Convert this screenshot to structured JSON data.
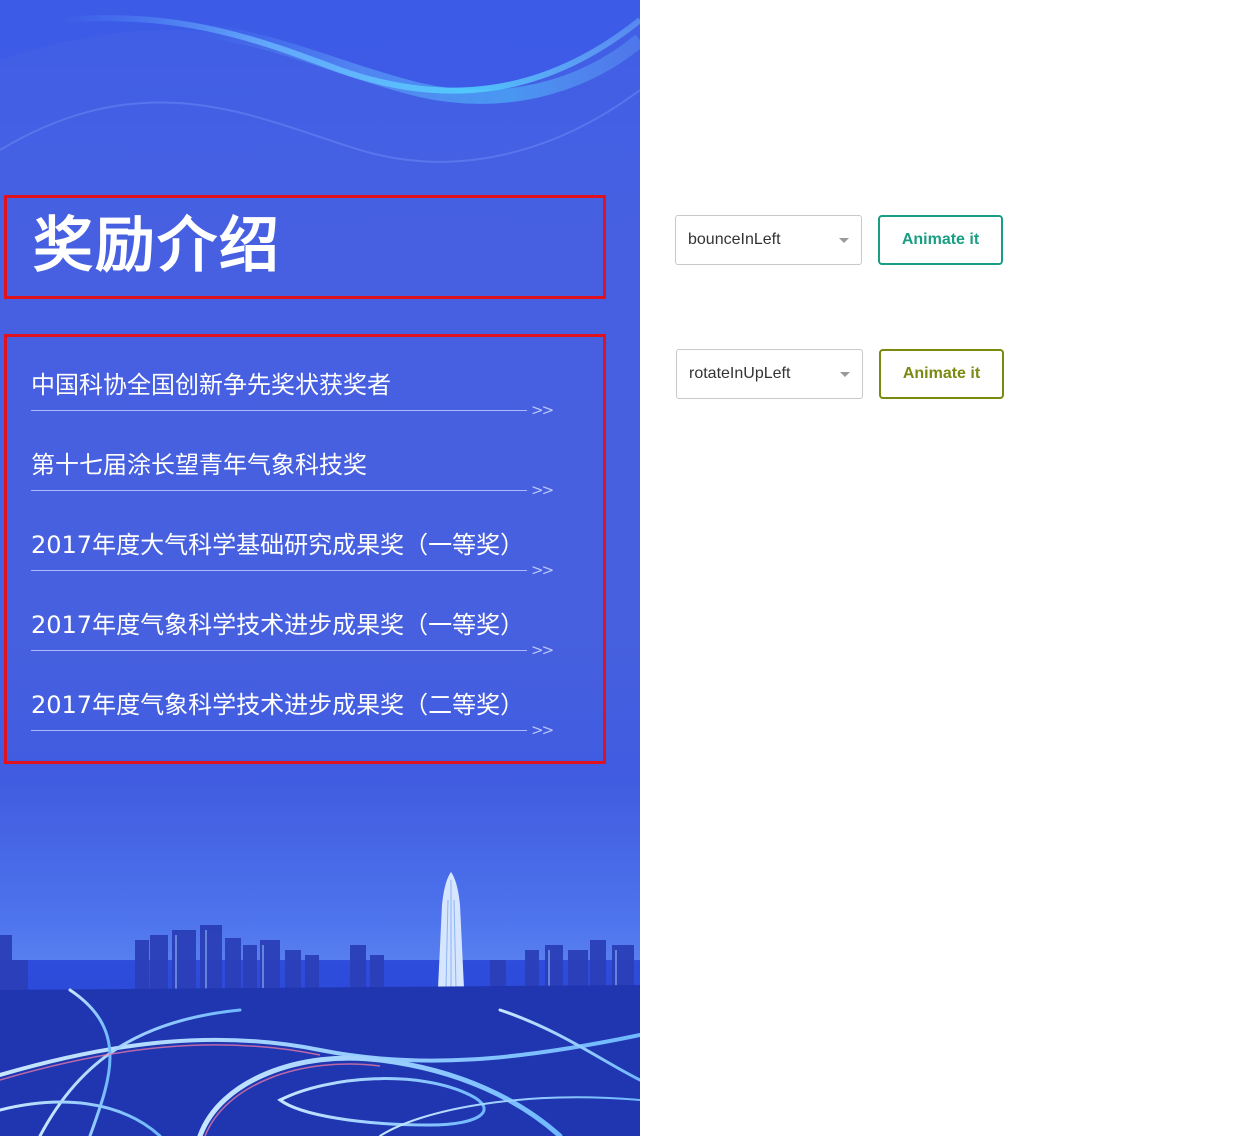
{
  "panel": {
    "title": "奖励介绍",
    "awards": [
      {
        "label": "中国科协全国创新争先奖状获奖者",
        "arrow": ">>"
      },
      {
        "label": "第十七届涂长望青年气象科技奖",
        "arrow": ">>"
      },
      {
        "label": "2017年度大气科学基础研究成果奖（一等奖）",
        "arrow": ">>"
      },
      {
        "label": "2017年度气象科学技术进步成果奖（一等奖）",
        "arrow": ">>"
      },
      {
        "label": "2017年度气象科学技术进步成果奖（二等奖）",
        "arrow": ">>"
      }
    ]
  },
  "controls": [
    {
      "select_value": "bounceInLeft",
      "button_label": "Animate it",
      "button_color": "#1a9e83"
    },
    {
      "select_value": "rotateInUpLeft",
      "button_label": "Animate it",
      "button_color": "#7a8a10"
    }
  ],
  "colors": {
    "highlight_border": "#e0121d",
    "panel_blue": "#4660df"
  }
}
